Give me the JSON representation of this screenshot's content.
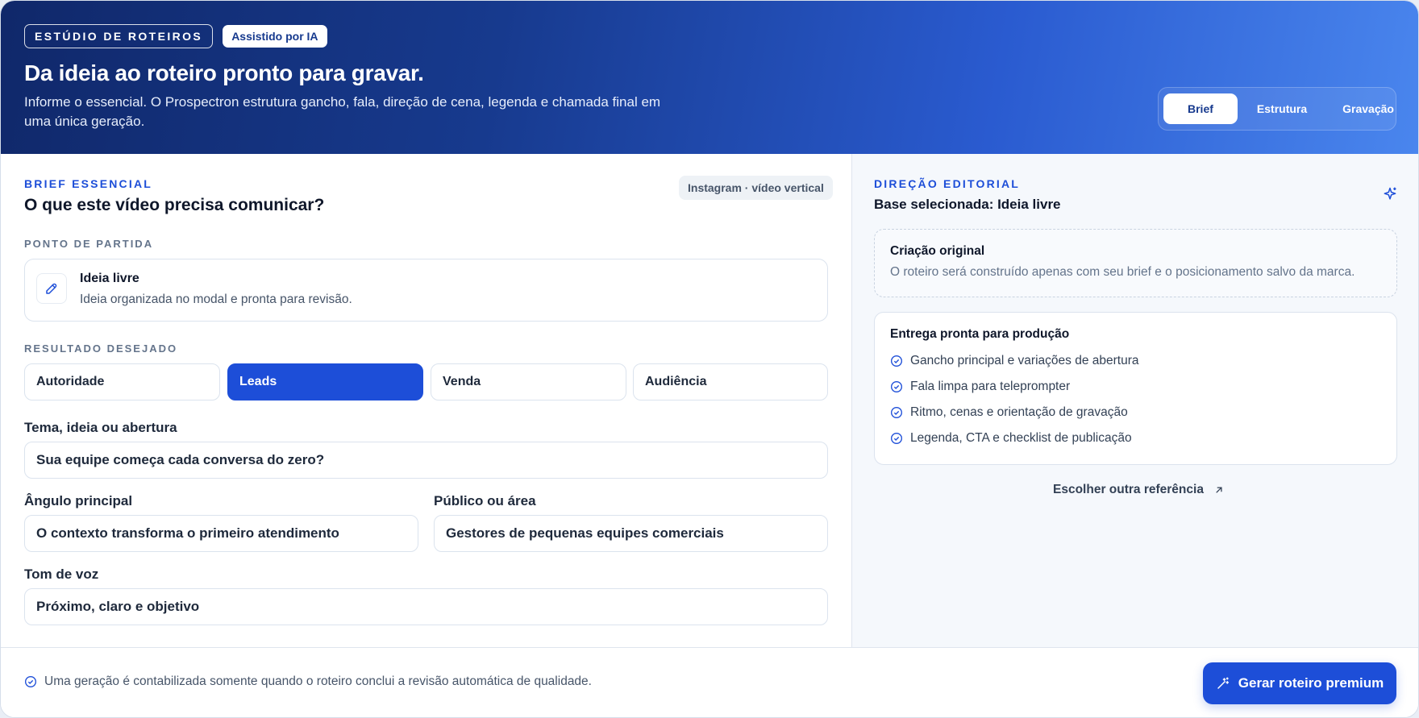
{
  "header": {
    "tag_studio": "ESTÚDIO DE ROTEIROS",
    "tag_ai": "Assistido por IA",
    "title": "Da ideia ao roteiro pronto para gravar.",
    "subtitle": "Informe o essencial. O Prospectron estrutura gancho, fala, direção de cena, legenda e chamada final em uma única geração.",
    "steps": [
      {
        "label": "Brief",
        "active": true
      },
      {
        "label": "Estrutura",
        "active": false
      },
      {
        "label": "Gravação",
        "active": false
      }
    ]
  },
  "brief": {
    "eyebrow": "BRIEF ESSENCIAL",
    "title": "O que este vídeo precisa comunicar?",
    "format_chip": "Instagram · vídeo vertical",
    "start_label": "PONTO DE PARTIDA",
    "start_card": {
      "title": "Ideia livre",
      "desc": "Ideia organizada no modal e pronta para revisão.",
      "icon": "pencil-icon"
    },
    "result_label": "RESULTADO DESEJADO",
    "results": [
      {
        "label": "Autoridade",
        "selected": false
      },
      {
        "label": "Leads",
        "selected": true
      },
      {
        "label": "Venda",
        "selected": false
      },
      {
        "label": "Audiência",
        "selected": false
      }
    ],
    "theme_label": "Tema, ideia ou abertura",
    "theme_value": "Sua equipe começa cada conversa do zero?",
    "angle_label": "Ângulo principal",
    "angle_value": "O contexto transforma o primeiro atendimento",
    "audience_label": "Público ou área",
    "audience_value": "Gestores de pequenas equipes comerciais",
    "tone_label": "Tom de voz",
    "tone_value": "Próximo, claro e objetivo"
  },
  "editorial": {
    "eyebrow": "DIREÇÃO EDITORIAL",
    "base": "Base selecionada: Ideia livre",
    "original_title": "Criação original",
    "original_desc": "O roteiro será construído apenas com seu brief e o posicionamento salvo da marca.",
    "delivery_title": "Entrega pronta para produção",
    "delivery_items": [
      "Gancho principal e variações de abertura",
      "Fala limpa para teleprompter",
      "Ritmo, cenas e orientação de gravação",
      "Legenda, CTA e checklist de publicação"
    ],
    "link": "Escolher outra referência"
  },
  "footer": {
    "note": "Uma geração é contabilizada somente quando o roteiro conclui a revisão automática de qualidade.",
    "cta": "Gerar roteiro premium"
  },
  "colors": {
    "accent": "#1d4ed8",
    "hero_dark": "#10286a",
    "hero_light": "#4a86ee"
  }
}
